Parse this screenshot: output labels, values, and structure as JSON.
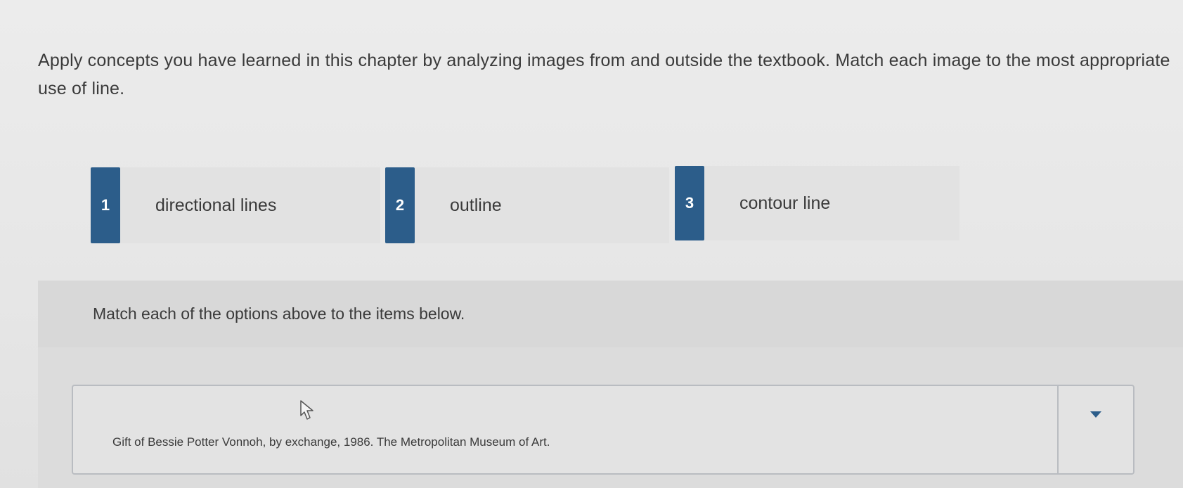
{
  "instructions": "Apply concepts you have learned in this chapter by analyzing images from and outside the textbook. Match each image to the most appropriate use of line.",
  "options": [
    {
      "number": "1",
      "label": "directional lines"
    },
    {
      "number": "2",
      "label": "outline"
    },
    {
      "number": "3",
      "label": "contour line"
    }
  ],
  "match": {
    "prompt": "Match each of the options above to the items below.",
    "items": [
      {
        "caption": "Gift of Bessie Potter Vonnoh, by exchange, 1986. The Metropolitan Museum of Art.",
        "image_icon": "broken-image-icon",
        "selected_value": ""
      }
    ]
  },
  "colors": {
    "accent": "#2c5d8a",
    "background": "#e7e7e7",
    "text": "#3a3a3a"
  }
}
